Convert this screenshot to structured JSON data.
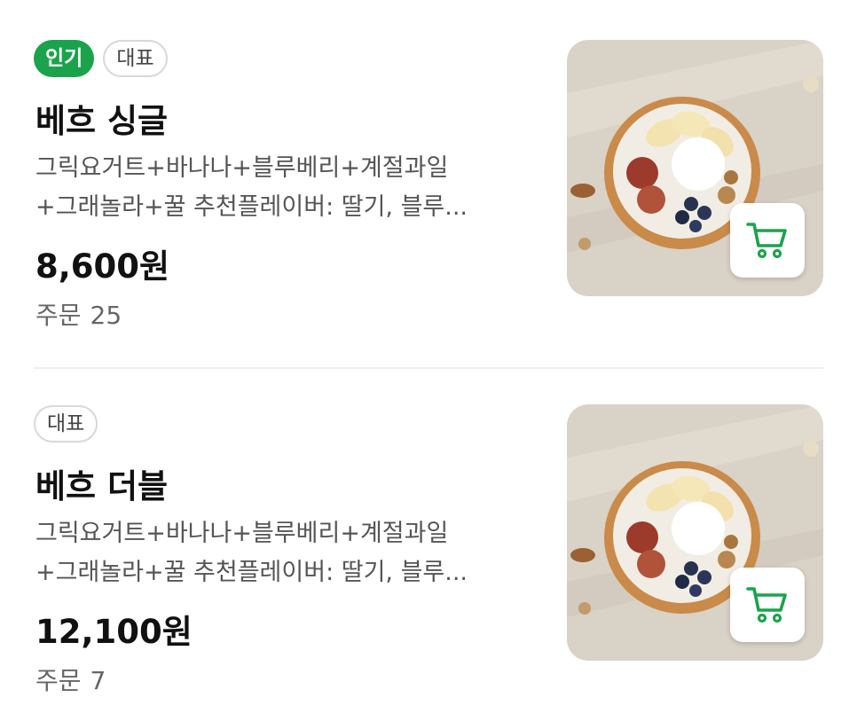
{
  "menu_items": [
    {
      "badges": [
        "인기",
        "대표"
      ],
      "name": "베흐 싱글",
      "description_line1": "그릭요거트+바나나+블루베리+계절과일",
      "description_line2": "+그래놀라+꿀 추천플레이버: 딸기, 블루...",
      "price": "8,600원",
      "orders_label": "주문",
      "orders_count": "25"
    },
    {
      "badges": [
        "대표"
      ],
      "name": "베흐 더블",
      "description_line1": "그릭요거트+바나나+블루베리+계절과일",
      "description_line2": "+그래놀라+꿀 추천플레이버: 딸기, 블루...",
      "price": "12,100원",
      "orders_label": "주문",
      "orders_count": "7"
    }
  ],
  "icons": {
    "cart": "shopping-cart-icon"
  },
  "colors": {
    "accent": "#1ba34b",
    "badge_border": "#d8d8d8"
  }
}
